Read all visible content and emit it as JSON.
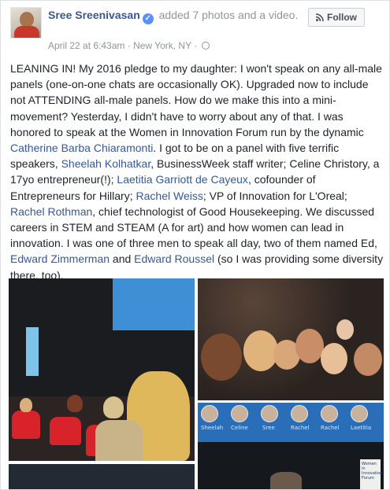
{
  "post": {
    "author": "Sree Sreenivasan",
    "action": "added 7 photos and a video.",
    "timestamp": "April 22 at 6:43am",
    "location": "New York, NY",
    "separator": " · ",
    "follow_label": "Follow",
    "text": {
      "t1": "LEANING IN! My 2016 pledge to my daughter: I won't speak on any all-male panels (one-on-one chats are occasionally OK). Upgraded now to include not ATTENDING all-male panels. How do we make this into a mini-movement? Yesterday, I didn't have to worry about any of that. I was honored to speak at the Women in Innovation Forum run by the dynamic ",
      "link1": "Catherine Barba Chiaramonti",
      "t2": ". I got to be on a panel with five terrific speakers, ",
      "link2": "Sheelah Kolhatkar",
      "t3": ", BusinessWeek staff writer; Celine Christory, a 17yo entrepreneur(!); ",
      "link3": "Laetitia Garriott de Cayeux",
      "t4": ", cofounder of Entrepreneurs for Hillary; ",
      "link4": "Rachel Weiss",
      "t5": "; VP of Innovation for L'Oreal; ",
      "link5": "Rachel Rothman",
      "t6": ", chief technologist of Good Housekeeping. We discussed careers in STEM and STEAM (A for art) and how women can lead in innovation. I was one of three men to speak all day, two of them named Ed, ",
      "link6": "Edward Zimmerman",
      "t7": " and ",
      "link7": "Edward Roussel",
      "t8": " (so I was providing some diversity there, too)."
    }
  },
  "photos": {
    "banner_names": [
      "Sheelah",
      "Celine",
      "Sree",
      "Rachel",
      "Rachel",
      "Laetitia"
    ],
    "poster_text": "Women in Innovation Forum"
  },
  "colors": {
    "link": "#365899",
    "meta": "#90949c",
    "text": "#1d2129",
    "verified": "#5890ff"
  },
  "icons": {
    "verified": "verified-badge-icon",
    "globe": "globe-icon",
    "follow": "rss-icon"
  }
}
